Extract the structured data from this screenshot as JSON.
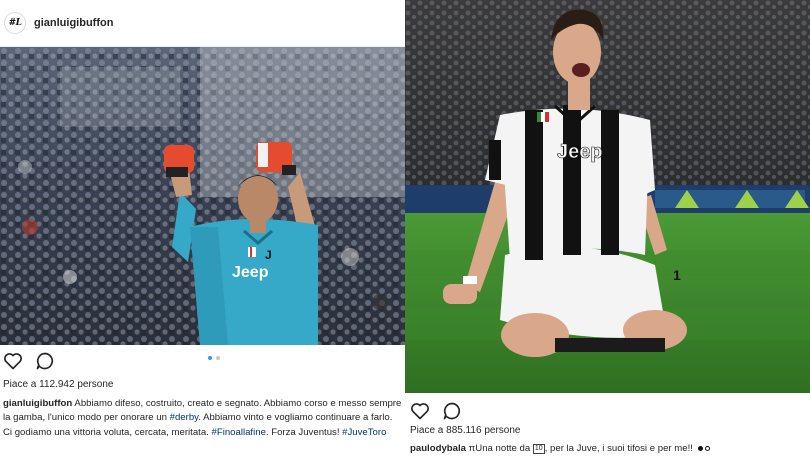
{
  "left_post": {
    "username": "gianluigibuffon",
    "avatar_text": "#L",
    "jersey_text": "Jeep",
    "jersey_logo": "J",
    "likes_text": "Piace a 112.942 persone",
    "caption": {
      "username": "gianluigibuffon",
      "part1": " Abbiamo difeso, costruito, creato e segnato. Abbiamo corso e messo sempre la gamba, l'unico modo per onorare un ",
      "tag1": "#derby",
      "part2": ". Abbiamo vinto e vogliamo continuare a farlo. Ci godiamo una vittoria voluta, cercata, meritata. ",
      "tag2": "#Finoallafine",
      "part3": ". Forza Juventus! ",
      "tag3": "#JuveToro"
    },
    "carousel": {
      "count": 2,
      "active": 1
    }
  },
  "right_post": {
    "jersey_text": "Jeep",
    "number": "1",
    "likes_text": "Piace a 885.116 persone",
    "caption": {
      "username": "paulodybala",
      "part1": " ",
      "script_glyph": "π",
      "part2": "Una notte da ",
      "box_label": "10",
      "part3": ", per la Juve, i suoi tifosi e per me!! "
    }
  },
  "icons": {
    "like": "heart-icon",
    "comment": "comment-icon"
  },
  "colors": {
    "keeper_kit": "#36a8c8",
    "glove": "#e44b2f",
    "tag_link": "#003569",
    "carousel_active": "#3897f0",
    "pitch": "#3f8a2c"
  }
}
